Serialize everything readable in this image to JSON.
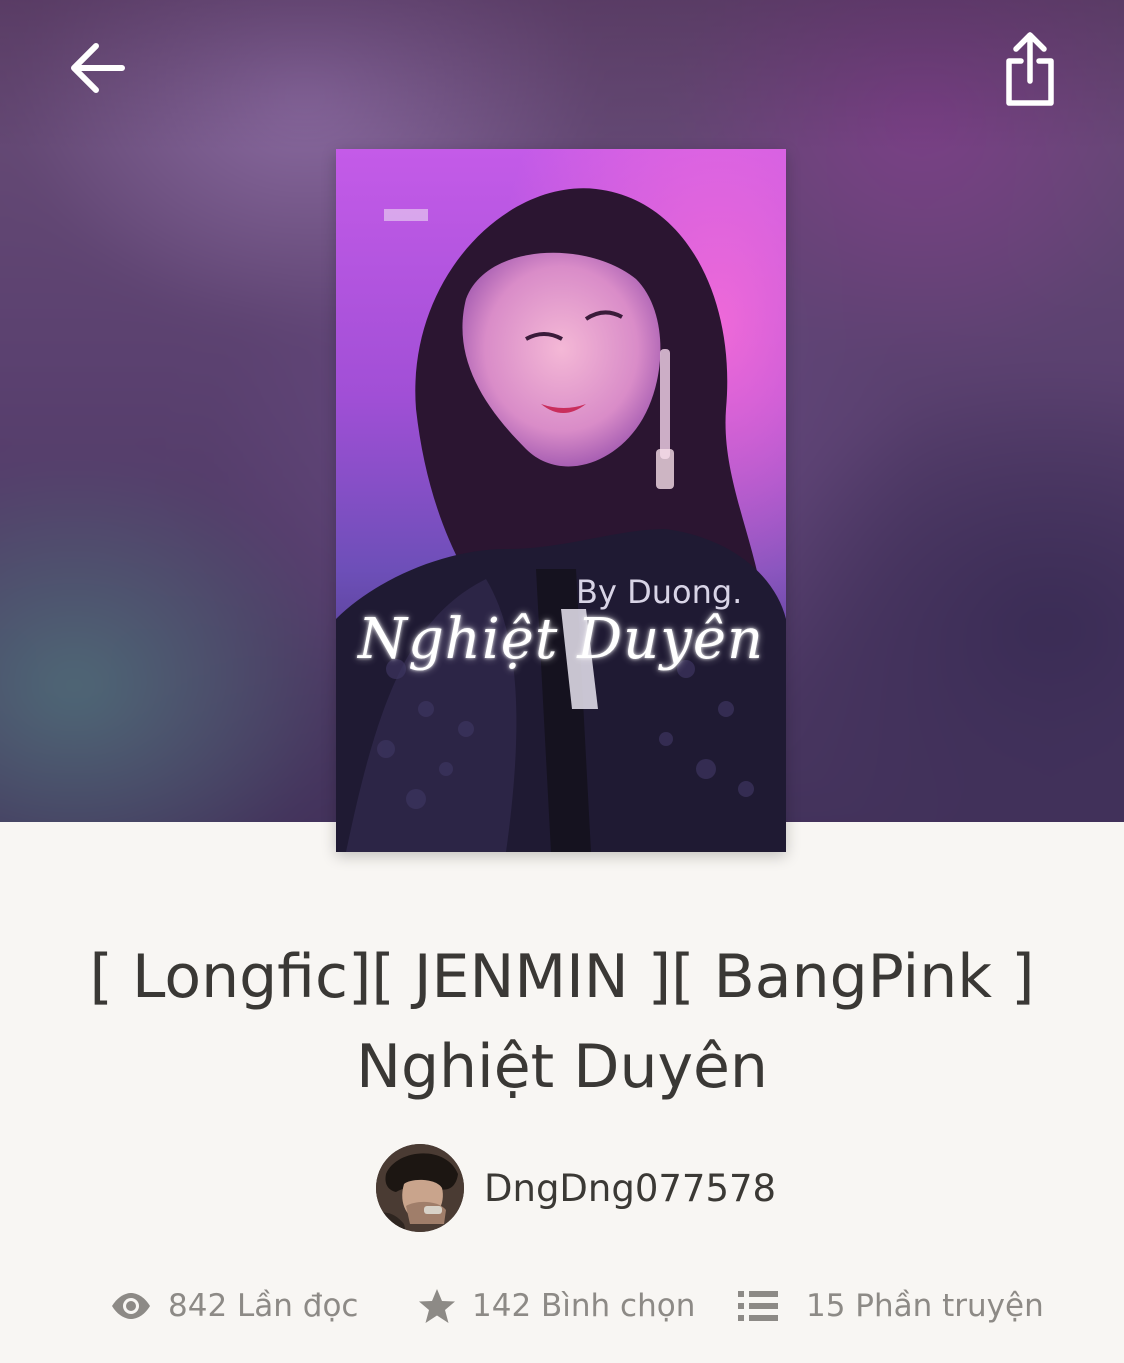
{
  "header": {
    "back_icon": "arrow-left-icon",
    "share_icon": "share-icon"
  },
  "cover": {
    "title_text": "Nghiệt Duyên",
    "byline_text": "By Duong.",
    "accent_color": "#b13ee0"
  },
  "story": {
    "title_line1": "[ Longfic][ JENMIN ][ BangPink ]",
    "title_line2": "Nghiệt Duyên"
  },
  "author": {
    "name": "DngDng077578"
  },
  "stats": {
    "reads": {
      "icon": "eye-icon",
      "label": "842 Lần đọc"
    },
    "votes": {
      "icon": "star-icon",
      "label": "142 Bình chọn"
    },
    "parts": {
      "icon": "list-icon",
      "label": "15 Phần truyện"
    }
  }
}
